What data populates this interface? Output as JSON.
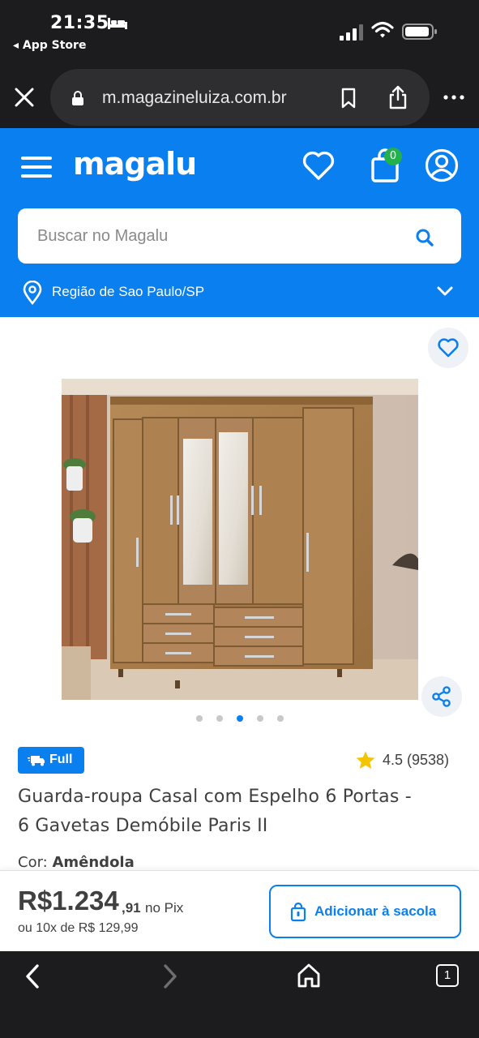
{
  "status_bar": {
    "time": "21:35",
    "back_app": "◂ App Store"
  },
  "browser": {
    "url": "m.magazineluiza.com.br"
  },
  "header": {
    "logo": "magalu",
    "cart_count": "0",
    "search_placeholder": "Buscar no Magalu",
    "region": "Região de Sao Paulo/SP",
    "brand_color": "#0a7ff0"
  },
  "product": {
    "carousel_total": 5,
    "carousel_active": 3,
    "badge": "Full",
    "rating": "4.5 (9538)",
    "title_line1": "Guarda-roupa Casal com Espelho 6 Portas -",
    "title_line2": "6 Gavetas Demóbile Paris II",
    "color_label": "Cor:",
    "color_value": "Amêndola"
  },
  "purchase": {
    "price_main": "R$1.234",
    "price_cents": ",91",
    "price_pix": "no Pix",
    "installments": "ou 10x de R$ 129,99",
    "add_label": "Adicionar à sacola"
  },
  "toolbar": {
    "tabs_count": "1"
  },
  "icons": [
    "bed-icon",
    "signal-icon",
    "wifi-icon",
    "battery-icon",
    "close-icon",
    "lock-icon",
    "bookmark-icon",
    "share-icon",
    "more-icon",
    "menu-icon",
    "heart-icon",
    "bag-icon",
    "user-icon",
    "search-icon",
    "pin-icon",
    "chevron-down-icon",
    "truck-icon",
    "star-icon",
    "back-icon",
    "forward-icon",
    "home-icon"
  ]
}
